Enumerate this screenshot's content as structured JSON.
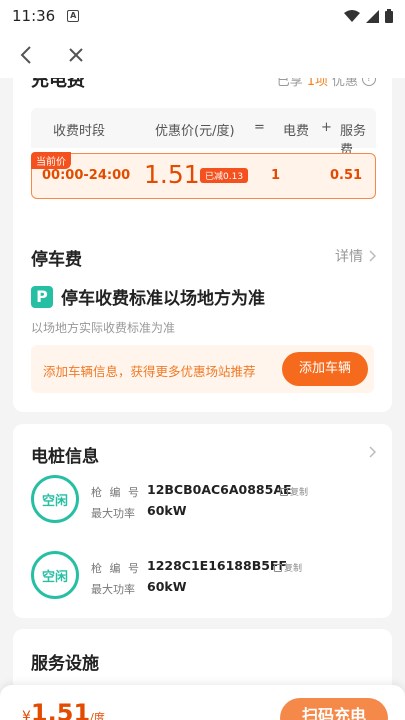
{
  "status_bar": {
    "time": "11:36"
  },
  "card_pricing": {
    "title": "充电费",
    "discount_prefix": "已享",
    "discount_count": "1项",
    "discount_suffix": "优惠",
    "header": {
      "period": "收费时段",
      "price": "优惠价(元/度)",
      "eq": "=",
      "electric": "电费",
      "plus": "+",
      "service": "服务费"
    },
    "current_tag": "当前价",
    "row": {
      "period": "00:00-24:00",
      "price": "1.51",
      "reduced": "已减0.13",
      "electric": "1",
      "service": "0.51"
    }
  },
  "card_parking": {
    "title": "停车费",
    "detail": "详情",
    "p_icon": "P",
    "headline": "停车收费标准以场地方为准",
    "sub": "以场地方实际收费标准为准",
    "banner_text": "添加车辆信息，获得更多优惠场站推荐",
    "banner_button": "添加车辆"
  },
  "card_piles": {
    "title": "电桩信息",
    "gun_label": "枪 编 号",
    "power_label": "最大功率",
    "copy_label": "复制",
    "piles": [
      {
        "status": "空闲",
        "code": "12BCB0AC6A0885AE",
        "power": "60kW"
      },
      {
        "status": "空闲",
        "code": "1228C1E16188B5FF",
        "power": "60kW"
      }
    ]
  },
  "card_facilities": {
    "title": "服务设施"
  },
  "bottom_bar": {
    "currency": "¥",
    "price": "1.51",
    "unit": "/度",
    "scan_button": "扫码充电"
  },
  "colors": {
    "accent": "#f56a1c",
    "price": "#e24b00",
    "idle": "#27bfa3"
  }
}
